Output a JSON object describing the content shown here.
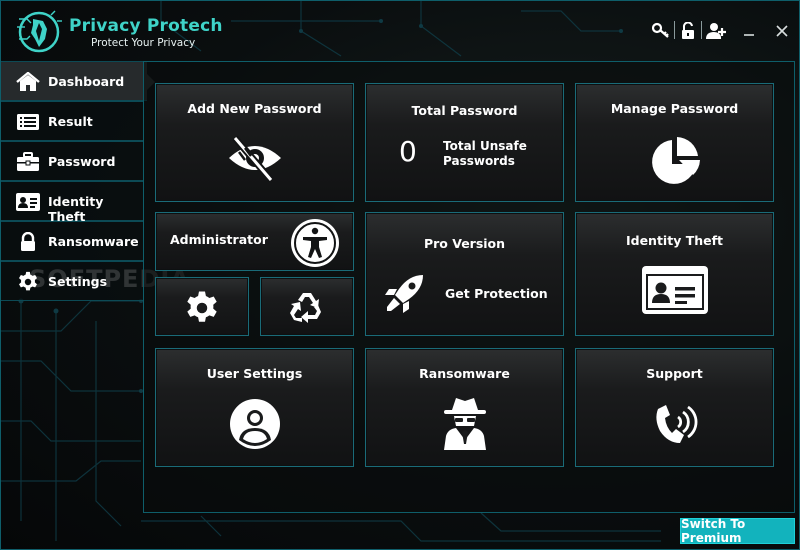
{
  "app": {
    "title": "Privacy Protech",
    "tagline": "Protect Your Privacy",
    "accent": "#3fd3c8",
    "border": "#0e5e6a"
  },
  "header_icons": [
    "key-icon",
    "unlock-icon",
    "add-user-icon",
    "minimize-icon",
    "close-icon"
  ],
  "sidebar": {
    "items": [
      {
        "label": "Dashboard",
        "icon": "home-icon",
        "active": true
      },
      {
        "label": "Result",
        "icon": "list-icon"
      },
      {
        "label": "Password",
        "icon": "briefcase-icon"
      },
      {
        "label": "Identity Theft",
        "icon": "id-card-icon"
      },
      {
        "label": "Ransomware",
        "icon": "lock-icon"
      },
      {
        "label": "Settings",
        "icon": "gear-icon"
      }
    ]
  },
  "tiles": {
    "add_password": {
      "title": "Add New Password",
      "icon": "eye-slash-icon"
    },
    "total_password": {
      "title": "Total Password",
      "count": "0",
      "unsafe_label_1": "Total Unsafe",
      "unsafe_label_2": "Passwords"
    },
    "manage_password": {
      "title": "Manage Password",
      "icon": "pie-chart-icon"
    },
    "administrator": {
      "title": "Administrator",
      "icon": "accessibility-icon"
    },
    "admin_settings": {
      "icon": "gear-icon"
    },
    "admin_recycle": {
      "icon": "recycle-icon"
    },
    "pro_version": {
      "title": "Pro Version",
      "action": "Get Protection",
      "icon": "rocket-icon"
    },
    "identity_theft": {
      "title": "Identity Theft",
      "icon": "id-card-icon"
    },
    "user_settings": {
      "title": "User Settings",
      "icon": "user-circle-icon"
    },
    "ransomware": {
      "title": "Ransomware",
      "icon": "spy-icon"
    },
    "support": {
      "title": "Support",
      "icon": "phone-icon"
    }
  },
  "premium_button": "Switch To Premium",
  "watermark": "SOFTPEDIA"
}
